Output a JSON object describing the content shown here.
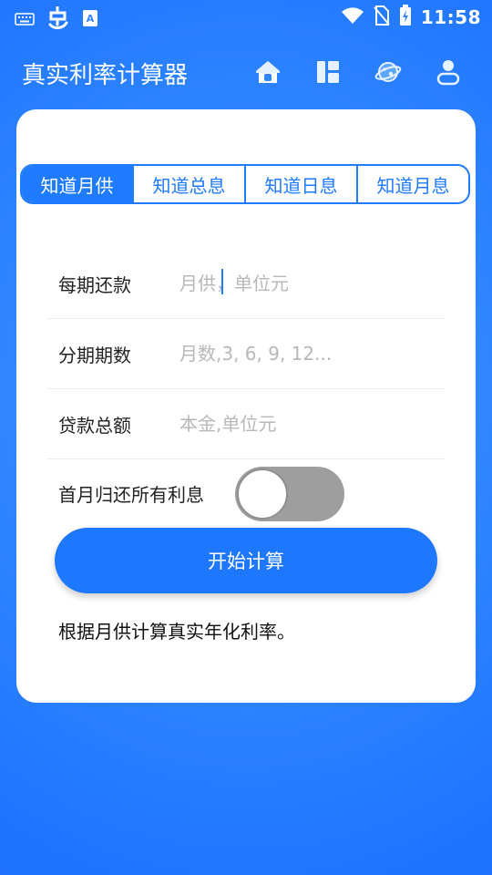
{
  "status_bar": {
    "time": "11:58",
    "left_icons": [
      "keyboard-icon",
      "bug-app-icon",
      "font-app-icon"
    ],
    "right_icons": [
      "wifi-icon",
      "no-sim-icon",
      "battery-charging-icon"
    ]
  },
  "app_bar": {
    "title": "真实利率计算器",
    "icons": [
      "home-icon",
      "dashboard-icon",
      "planet-icon",
      "user-icon"
    ]
  },
  "tabs": [
    {
      "label": "知道月供",
      "active": true
    },
    {
      "label": "知道总息",
      "active": false
    },
    {
      "label": "知道日息",
      "active": false
    },
    {
      "label": "知道月息",
      "active": false
    }
  ],
  "form": {
    "fields": [
      {
        "label": "每期还款",
        "value": "",
        "placeholder": "月供，单位元"
      },
      {
        "label": "分期期数",
        "value": "",
        "placeholder": "月数,3, 6, 9, 12..."
      },
      {
        "label": "贷款总额",
        "value": "",
        "placeholder": "本金,单位元"
      }
    ],
    "toggle": {
      "label": "首月归还所有利息",
      "on": false
    }
  },
  "start_button": "开始计算",
  "description": "根据月供计算真实年化利率。",
  "colors": {
    "accent": "#1f7bff",
    "toggle_off": "#9e9e9e"
  }
}
